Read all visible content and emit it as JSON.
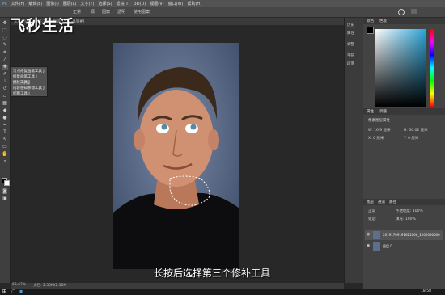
{
  "menu": [
    "文件(F)",
    "编辑(E)",
    "图像(I)",
    "图层(L)",
    "文字(Y)",
    "选择(S)",
    "滤镜(T)",
    "3D(D)",
    "视图(V)",
    "窗口(W)",
    "帮助(H)"
  ],
  "options": {
    "mode": "正常",
    "source": "源",
    "pattern": "图案",
    "transparent": "透明",
    "content_aware": "使用图案"
  },
  "tab": {
    "label": "未标题-1 @ 66.7% (图层 1, RGB/8#)"
  },
  "brand": {
    "text": "飞秒生活"
  },
  "flyout": {
    "items": [
      "污点修复画笔工具  J",
      "修复画笔工具  J",
      "修补工具  J",
      "内容感知移动工具  J",
      "红眼工具  J"
    ]
  },
  "caption": {
    "text": "长按后选择第三个修补工具"
  },
  "status": {
    "zoom": "66.67%",
    "doc": "文档: 2.50M/2.50M"
  },
  "mini_panel": {
    "items": [
      "历史",
      "属性",
      "调整",
      "字符",
      "段落"
    ]
  },
  "color_panel": {
    "tabs": [
      "颜色",
      "色板"
    ],
    "hue_color": "#3a9ad0"
  },
  "properties": {
    "tabs": [
      "属性",
      "调整"
    ],
    "title": "像素图层属性",
    "w_label": "W: 16.9 厘米",
    "h_label": "H: 30.02 厘米",
    "x_label": "X: 0 厘米",
    "y_label": "Y: 0 厘米"
  },
  "layers": {
    "tabs": [
      "图层",
      "通道",
      "路径"
    ],
    "blend": "正常",
    "opacity": "不透明度: 100%",
    "fill": "填充: 100%",
    "lock": "锁定:",
    "rows": [
      {
        "name": "20191709191621066_1000000000",
        "selected": true
      },
      {
        "name": "图层 0",
        "selected": false
      }
    ]
  },
  "taskbar": {
    "time": "18:58"
  }
}
